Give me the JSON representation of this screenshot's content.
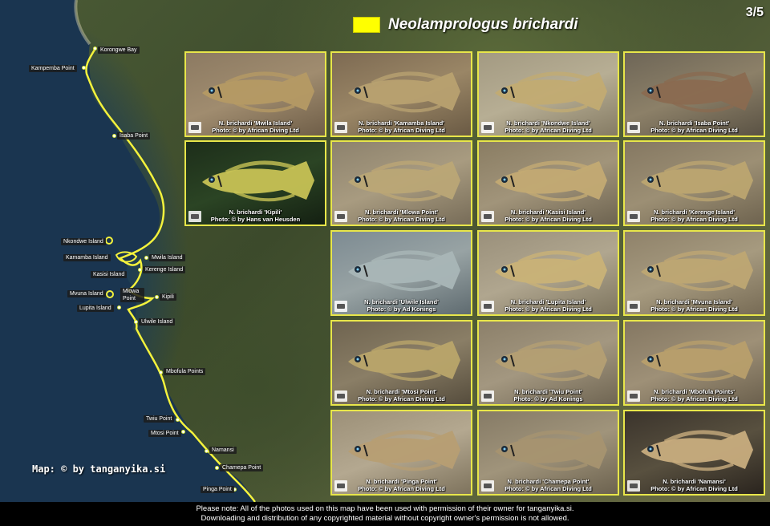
{
  "legend": {
    "species": "Neolamprologus brichardi",
    "color": "#ffff00"
  },
  "page_indicator": "3/5",
  "map_credit": "Map: © by tanganyika.si",
  "locations": [
    "Korongwe Bay",
    "Kampemba Point",
    "Isaba Point",
    "Nkondwe Island",
    "Kamamba Island",
    "Mwila Island",
    "Kerenge Island",
    "Kasisi Island",
    "Mlowa Point",
    "Kipili",
    "Mvuna Island",
    "Lupita Island",
    "Ulwile Island",
    "Mbofula Points",
    "Twiu Point",
    "Mtosi Point",
    "Namansi",
    "Chamepa Point",
    "Pinga Point"
  ],
  "photos": [
    {
      "name": "N. brichardi 'Mwila Island'",
      "credit": "Photo: © by African Diving Ltd"
    },
    {
      "name": "N. brichardi 'Kamamba Island'",
      "credit": "Photo: © by African Diving Ltd"
    },
    {
      "name": "N. brichardi 'Nkondwe Island'",
      "credit": "Photo: © by African Diving Ltd"
    },
    {
      "name": "N. brichardi 'Isaba Point'",
      "credit": "Photo: © by African Diving Ltd"
    },
    {
      "name": "N. brichardi 'Kipili'",
      "credit": "Photo: © by Hans van Heusden"
    },
    {
      "name": "N. brichardi 'Mlowa Point'",
      "credit": "Photo: © by African Diving Ltd"
    },
    {
      "name": "N. brichardi 'Kasisi Island'",
      "credit": "Photo: © by African Diving Ltd"
    },
    {
      "name": "N. brichardi 'Kerenge Island'",
      "credit": "Photo: © by African Diving Ltd"
    },
    {
      "name": "N. brichardi 'Ulwile Island'",
      "credit": "Photo: © by Ad Konings"
    },
    {
      "name": "N. brichardi 'Lupita Island'",
      "credit": "Photo: © by African Diving Ltd"
    },
    {
      "name": "N. brichardi 'Mvuna Island'",
      "credit": "Photo: © by African Diving Ltd"
    },
    {
      "name": "N. brichardi 'Mtosi Point'",
      "credit": "Photo: © by African Diving Ltd"
    },
    {
      "name": "N. brichardi 'Twiu Point'",
      "credit": "Photo: © by Ad Konings"
    },
    {
      "name": "N. brichardi 'Mbofula Points'",
      "credit": "Photo: © by African Diving Ltd"
    },
    {
      "name": "N. brichardi 'Pinga Point'",
      "credit": "Photo: © by African Diving Ltd"
    },
    {
      "name": "N. brichardi 'Chamepa Point'",
      "credit": "Photo: © by African Diving Ltd"
    },
    {
      "name": "N. brichardi 'Namansi'",
      "credit": "Photo: © by African Diving Ltd"
    }
  ],
  "footer": {
    "line1": "Please note: All of the photos used on this map have been used with permission of their owner for tanganyika.si.",
    "line2": "Downloading and distribution of any copyrighted material without copyright owner's permission is not allowed."
  }
}
